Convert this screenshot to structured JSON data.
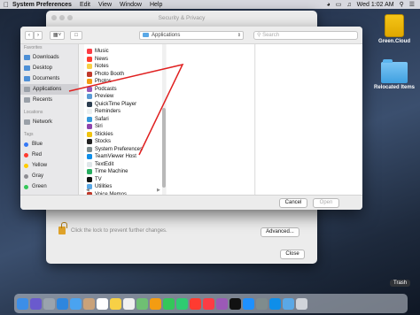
{
  "menubar": {
    "app_name": "System Preferences",
    "menus": [
      "Edit",
      "View",
      "Window",
      "Help"
    ],
    "clock": "Wed 1:02 AM"
  },
  "desktop": {
    "icons": [
      {
        "label": "Green.Cloud",
        "type": "drive"
      },
      {
        "label": "Relocated Items",
        "type": "folder"
      }
    ]
  },
  "security_window": {
    "title": "Security & Privacy",
    "lock_text": "Click the lock to prevent further changes.",
    "advanced_label": "Advanced...",
    "close_label": "Close"
  },
  "dialog": {
    "path": "Applications",
    "search_placeholder": "Search",
    "sidebar": {
      "favorites_header": "Favorites",
      "favorites": [
        {
          "label": "Downloads",
          "icon": "downloads-icon"
        },
        {
          "label": "Desktop",
          "icon": "desktop-icon"
        },
        {
          "label": "Documents",
          "icon": "documents-icon"
        },
        {
          "label": "Applications",
          "icon": "applications-icon"
        },
        {
          "label": "Recents",
          "icon": "recents-icon"
        }
      ],
      "locations_header": "Locations",
      "locations": [
        {
          "label": "Network",
          "icon": "network-icon"
        }
      ],
      "tags_header": "Tags",
      "tags": [
        {
          "label": "Blue",
          "color": "#3478f6"
        },
        {
          "label": "Red",
          "color": "#ff3b30"
        },
        {
          "label": "Yellow",
          "color": "#ffcc00"
        },
        {
          "label": "Gray",
          "color": "#8e8e93"
        },
        {
          "label": "Green",
          "color": "#34c759"
        }
      ]
    },
    "files": [
      {
        "name": "Music",
        "color": "#fc3c44"
      },
      {
        "name": "News",
        "color": "#ff3b30"
      },
      {
        "name": "Notes",
        "color": "#f7d046"
      },
      {
        "name": "Photo Booth",
        "color": "#c0392b"
      },
      {
        "name": "Photos",
        "color": "#f39c12"
      },
      {
        "name": "Podcasts",
        "color": "#9b59b6"
      },
      {
        "name": "Preview",
        "color": "#5a9bd5"
      },
      {
        "name": "QuickTime Player",
        "color": "#2c3e50"
      },
      {
        "name": "Reminders",
        "color": "#ecf0f1"
      },
      {
        "name": "Safari",
        "color": "#3498db"
      },
      {
        "name": "Siri",
        "color": "#8e44ad"
      },
      {
        "name": "Stickies",
        "color": "#f1c40f"
      },
      {
        "name": "Stocks",
        "color": "#222222"
      },
      {
        "name": "System Preferences",
        "color": "#7f8c8d"
      },
      {
        "name": "TeamViewer Host",
        "color": "#0e8ee9"
      },
      {
        "name": "TextEdit",
        "color": "#dfe6e9"
      },
      {
        "name": "Time Machine",
        "color": "#27ae60"
      },
      {
        "name": "TV",
        "color": "#111111"
      },
      {
        "name": "Utilities",
        "color": "#5aa8e6"
      },
      {
        "name": "Voice Memos",
        "color": "#c0392b"
      }
    ],
    "cancel_label": "Cancel",
    "open_label": "Open"
  },
  "dock": {
    "trash_tooltip": "Trash",
    "icons": [
      {
        "name": "finder-icon",
        "color": "#3c8ee8"
      },
      {
        "name": "siri-icon",
        "color": "#6a5acd"
      },
      {
        "name": "launchpad-icon",
        "color": "#9aa3ad"
      },
      {
        "name": "safari-icon",
        "color": "#2e86de"
      },
      {
        "name": "mail-icon",
        "color": "#4aa3f0"
      },
      {
        "name": "contacts-icon",
        "color": "#c9a27a"
      },
      {
        "name": "calendar-icon",
        "color": "#ffffff"
      },
      {
        "name": "notes-icon",
        "color": "#f7d046"
      },
      {
        "name": "reminders-icon",
        "color": "#f0f0f0"
      },
      {
        "name": "maps-icon",
        "color": "#6fbf73"
      },
      {
        "name": "photos-icon",
        "color": "#f39c12"
      },
      {
        "name": "messages-icon",
        "color": "#34c759"
      },
      {
        "name": "facetime-icon",
        "color": "#2ecc71"
      },
      {
        "name": "news-icon",
        "color": "#ff3b30"
      },
      {
        "name": "music-icon",
        "color": "#fc3c44"
      },
      {
        "name": "podcasts-icon",
        "color": "#9b59b6"
      },
      {
        "name": "tv-icon",
        "color": "#111111"
      },
      {
        "name": "app-store-icon",
        "color": "#1e90ff"
      },
      {
        "name": "system-preferences-icon",
        "color": "#7f8c8d"
      },
      {
        "name": "teamviewer-icon",
        "color": "#0e8ee9"
      },
      {
        "name": "downloads-folder-icon",
        "color": "#5aa8e6"
      },
      {
        "name": "trash-icon",
        "color": "#d0d4da"
      }
    ]
  }
}
